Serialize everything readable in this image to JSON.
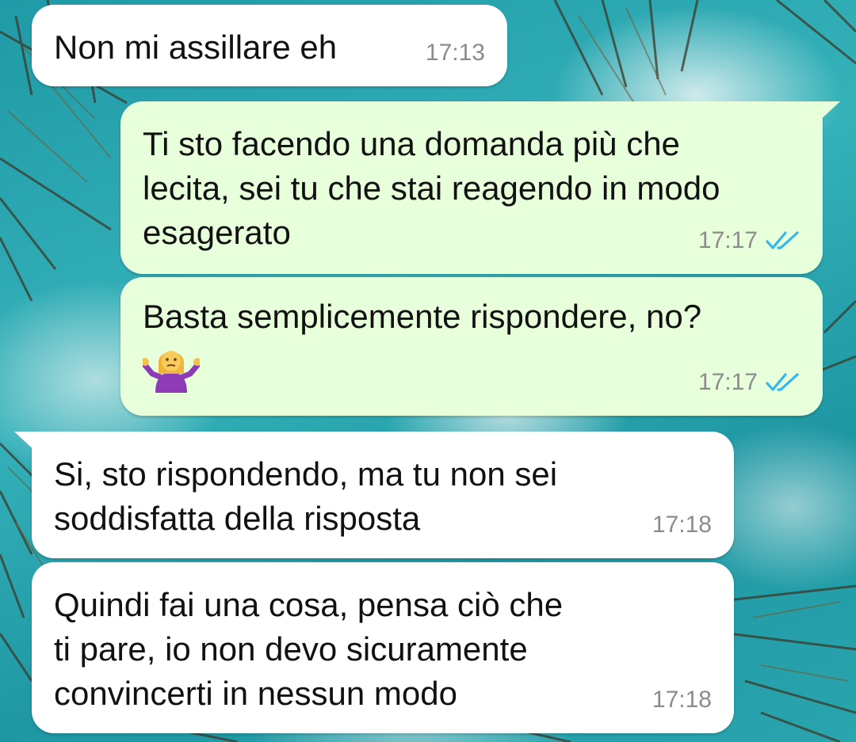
{
  "chat": {
    "messages": [
      {
        "direction": "incoming",
        "text": "Non mi assillare eh",
        "time": "17:13"
      },
      {
        "direction": "outgoing",
        "text": "Ti sto facendo una domanda più che\nlecita, sei tu che stai reagendo in modo\nesagerato",
        "time": "17:17",
        "status": "read"
      },
      {
        "direction": "outgoing",
        "text": "Basta semplicemente rispondere, no?",
        "emoji": "person-shrugging-emoji",
        "time": "17:17",
        "status": "read"
      },
      {
        "direction": "incoming",
        "text": "Si, sto rispondendo, ma tu non sei\nsoddisfatta della risposta",
        "time": "17:18"
      },
      {
        "direction": "incoming",
        "text": "Quindi fai una cosa, pensa ciò che\nti pare, io non devo sicuramente\nconvincerti in nessun modo",
        "time": "17:18"
      }
    ]
  },
  "colors": {
    "incoming_bubble": "#ffffff",
    "outgoing_bubble": "#e7ffdb",
    "read_check": "#34b7f1",
    "timestamp": "#8c8c8c"
  }
}
